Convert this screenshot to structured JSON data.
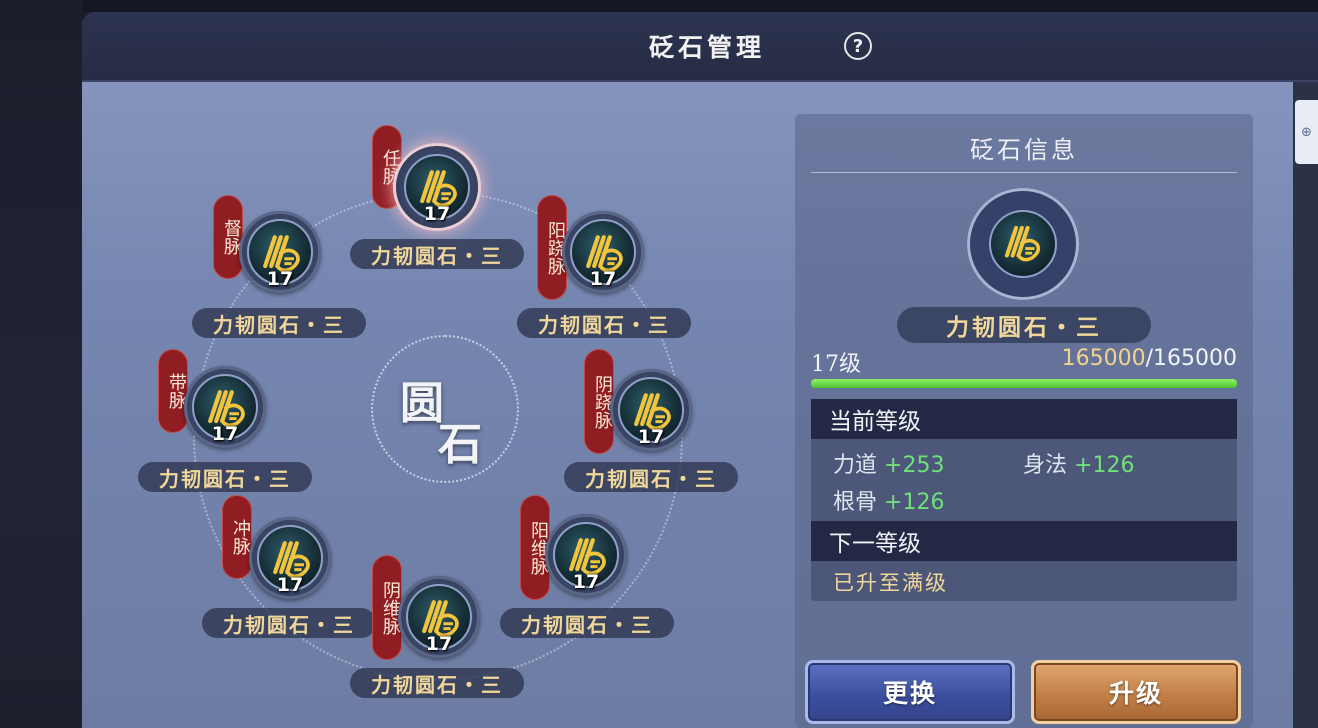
{
  "window": {
    "title": "砭石管理",
    "help_label": "?"
  },
  "side_tab_icon": "⊕",
  "wheel": {
    "center_chars": [
      "圆",
      "石"
    ],
    "slots": [
      {
        "meridian": "任脉",
        "level": "17",
        "stone_name": "力韧圆石・三",
        "selected": true
      },
      {
        "meridian": "督脉",
        "level": "17",
        "stone_name": "力韧圆石・三"
      },
      {
        "meridian": "阳跷脉",
        "level": "17",
        "stone_name": "力韧圆石・三"
      },
      {
        "meridian": "带脉",
        "level": "17",
        "stone_name": "力韧圆石・三"
      },
      {
        "meridian": "阴跷脉",
        "level": "17",
        "stone_name": "力韧圆石・三"
      },
      {
        "meridian": "冲脉",
        "level": "17",
        "stone_name": "力韧圆石・三"
      },
      {
        "meridian": "阳维脉",
        "level": "17",
        "stone_name": "力韧圆石・三"
      },
      {
        "meridian": "阴维脉",
        "level": "17",
        "stone_name": "力韧圆石・三"
      }
    ]
  },
  "info": {
    "title": "砭石信息",
    "stone_name": "力韧圆石・三",
    "level_label": "17级",
    "exp_current": "165000",
    "exp_max": "/165000",
    "exp_progress": 1.0,
    "current_header": "当前等级",
    "stats": [
      {
        "name": "力道",
        "value": "+253"
      },
      {
        "name": "身法",
        "value": "+126"
      },
      {
        "name": "根骨",
        "value": "+126"
      }
    ],
    "next_header": "下一等级",
    "next_text": "已升至满级"
  },
  "buttons": {
    "swap": "更换",
    "upgrade": "升级"
  },
  "colors": {
    "stat_green": "#6fe07a",
    "name_gold": "#f1d89a",
    "tag_red": "#8f1d22"
  },
  "icons": {
    "gem": "stone-rune-icon"
  }
}
